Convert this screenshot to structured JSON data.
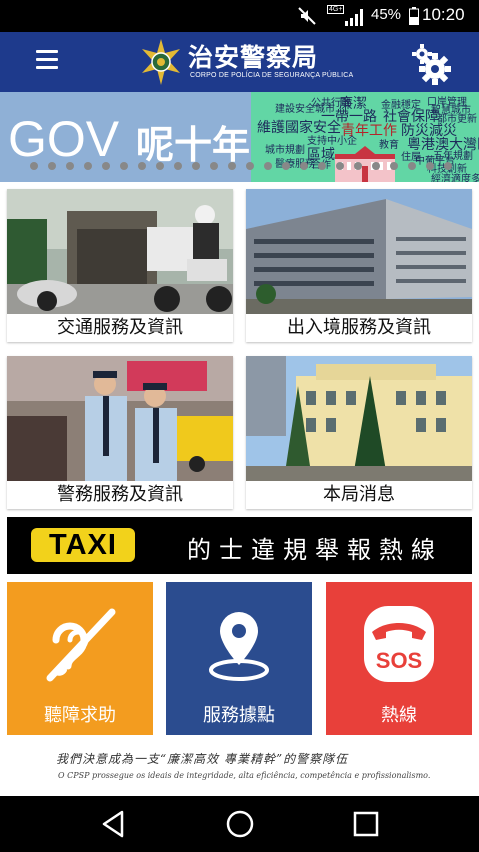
{
  "status_bar": {
    "battery_percent": "45%",
    "time": "10:20",
    "network_badge": "4G+"
  },
  "header": {
    "title": "治安警察局",
    "subtitle": "CORPO DE POLÍCIA DE SEGURANÇA PÚBLICA",
    "menu_icon": "hamburger-menu-icon",
    "settings_icon": "gear-icon",
    "color": "#1e3a8c"
  },
  "banner": {
    "logo_text": "GOV",
    "title": "呢十年",
    "words": [
      "公共行政",
      "廉潔",
      "金融穩定",
      "口岸管理",
      "智慧城市",
      "建設安全城市",
      "一帶一路",
      "社會保障",
      "都市更新",
      "維護國家安全",
      "青年工作",
      "防災減災",
      "教育",
      "粵港澳大灣區",
      "支持中小企",
      "區域",
      "住屋",
      "中葡平台",
      "五年規劃",
      "城市規劃",
      "醫療服務",
      "合作",
      "科技創新",
      "經濟適度多元"
    ]
  },
  "tiles": [
    {
      "label": "交通服務及資訊"
    },
    {
      "label": "出入境服務及資訊"
    },
    {
      "label": "警務服務及資訊"
    },
    {
      "label": "本局消息"
    }
  ],
  "taxi": {
    "badge": "TAXI",
    "text": "的士違規舉報熱線"
  },
  "buttons": [
    {
      "label": "聽障求助",
      "color": "#f39c1f",
      "icon": "ear-icon"
    },
    {
      "label": "服務據點",
      "color": "#2b4c8f",
      "icon": "map-pin-icon"
    },
    {
      "label": "熱線",
      "color": "#e8403a",
      "icon": "sos-phone-icon",
      "sos": "SOS"
    }
  ],
  "motto": {
    "line1": "我們決意成為一支“廉潔高效 專業精幹”的警察隊伍",
    "line2": "O CPSP prossegue os ideais de integridade, alta eficiência, competência e profissionalismo."
  }
}
